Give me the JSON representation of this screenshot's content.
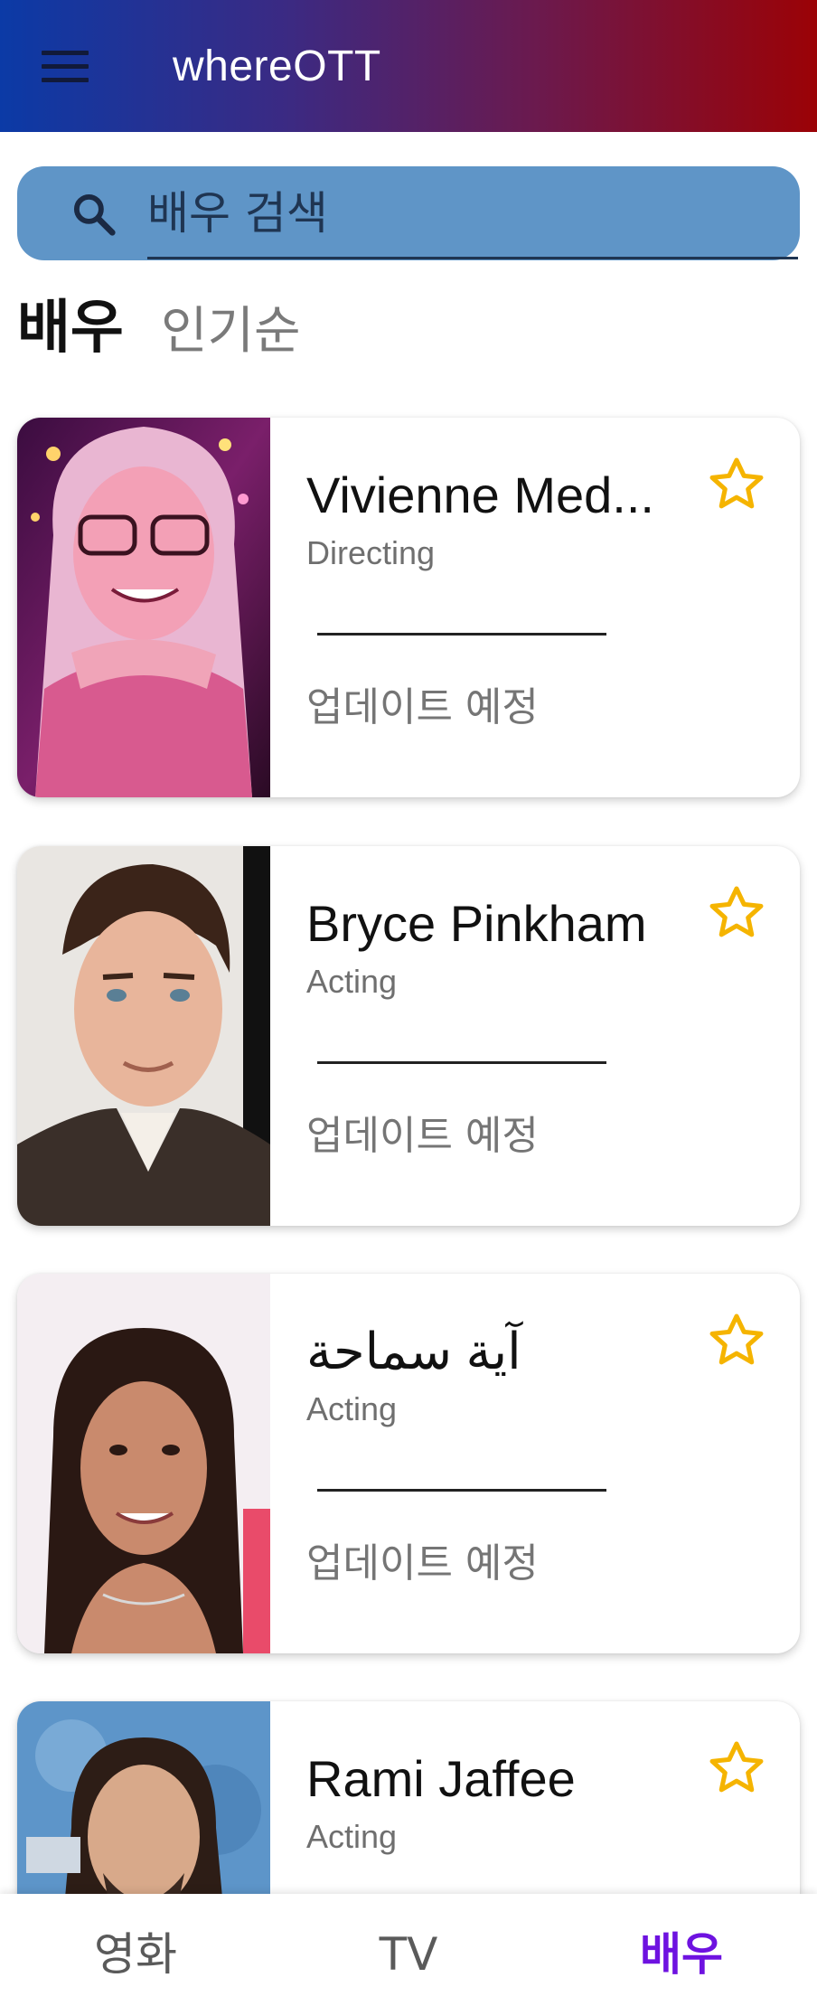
{
  "app": {
    "title": "whereOTT"
  },
  "search": {
    "placeholder": "배우 검색"
  },
  "section": {
    "title": "배우",
    "sort": "인기순"
  },
  "people": [
    {
      "name": "Vivienne Med...",
      "department": "Directing",
      "status": "업데이트 예정"
    },
    {
      "name": "آية سماحة",
      "department": "Acting",
      "status": "업데이트 예정"
    },
    {
      "name": "Bryce Pinkham",
      "department": "Acting",
      "status": "업데이트 예정"
    },
    {
      "name": "Rami Jaffee",
      "department": "Acting",
      "status": ""
    }
  ],
  "nav": {
    "items": [
      {
        "label": "영화"
      },
      {
        "label": "TV"
      },
      {
        "label": "배우"
      }
    ],
    "active": "배우"
  },
  "colors": {
    "header_start": "#0b3aa6",
    "header_end": "#9b0206",
    "search_bg": "#5f95c7",
    "star": "#f5b400",
    "nav_active": "#6e12e0"
  },
  "icons": {
    "menu": "hamburger-menu-icon",
    "search": "search-icon",
    "favorite": "star-outline-icon"
  }
}
